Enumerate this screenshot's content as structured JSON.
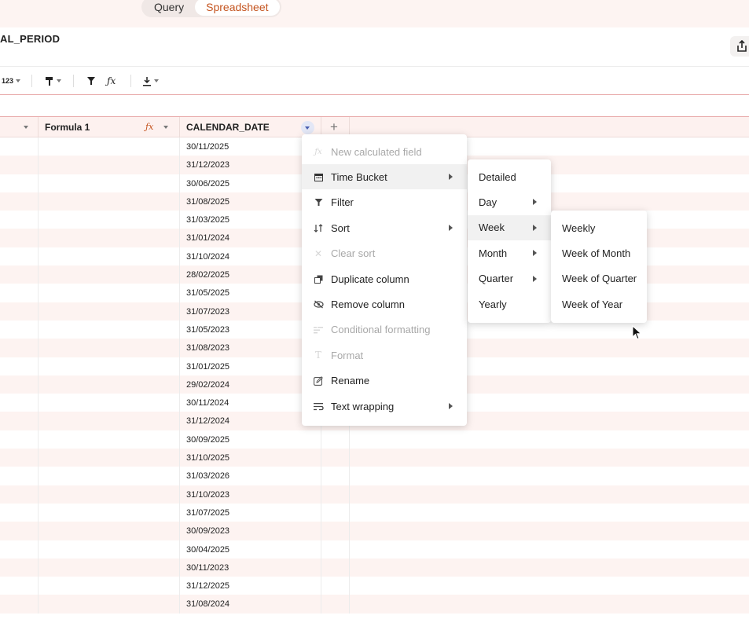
{
  "view_toggle": {
    "query": "Query",
    "spreadsheet": "Spreadsheet"
  },
  "title": "AL_PERIOD",
  "toolbar": {
    "number_format": "123"
  },
  "columns": {
    "formula": "Formula 1",
    "calendar_date": "CALENDAR_DATE"
  },
  "dates": [
    "30/11/2025",
    "31/12/2023",
    "30/06/2025",
    "31/08/2025",
    "31/03/2025",
    "31/01/2024",
    "31/10/2024",
    "28/02/2025",
    "31/05/2025",
    "31/07/2023",
    "31/05/2023",
    "31/08/2023",
    "31/01/2025",
    "29/02/2024",
    "30/11/2024",
    "31/12/2024",
    "30/09/2025",
    "31/10/2025",
    "31/03/2026",
    "31/10/2023",
    "31/07/2025",
    "30/09/2023",
    "30/04/2025",
    "30/11/2023",
    "31/12/2025",
    "31/08/2024"
  ],
  "context_menu": {
    "items": [
      {
        "label": "New calculated field",
        "icon": "fx-icon",
        "disabled": true
      },
      {
        "label": "Time Bucket",
        "icon": "calendar-icon",
        "submenu": true
      },
      {
        "label": "Filter",
        "icon": "filter-icon"
      },
      {
        "label": "Sort",
        "icon": "sort-icon",
        "submenu": true
      },
      {
        "label": "Clear sort",
        "icon": "close-icon",
        "disabled": true
      },
      {
        "label": "Duplicate column",
        "icon": "duplicate-icon"
      },
      {
        "label": "Remove column",
        "icon": "eye-off-icon"
      },
      {
        "label": "Conditional formatting",
        "icon": "conditional-formatting-icon",
        "disabled": true
      },
      {
        "label": "Format",
        "icon": "text-format-icon",
        "disabled": true
      },
      {
        "label": "Rename",
        "icon": "edit-icon"
      },
      {
        "label": "Text wrapping",
        "icon": "wrap-icon",
        "submenu": true
      }
    ]
  },
  "time_bucket_menu": {
    "items": [
      "Detailed",
      "Day",
      "Week",
      "Month",
      "Quarter",
      "Yearly"
    ]
  },
  "week_menu": {
    "items": [
      "Weekly",
      "Week of Month",
      "Week of Quarter",
      "Week of Year"
    ]
  },
  "colors": {
    "accent": "#c4541f",
    "header_bg": "#fdf1ef",
    "row_alt": "#fdf3f1",
    "border_red": "#e8a9a9"
  }
}
